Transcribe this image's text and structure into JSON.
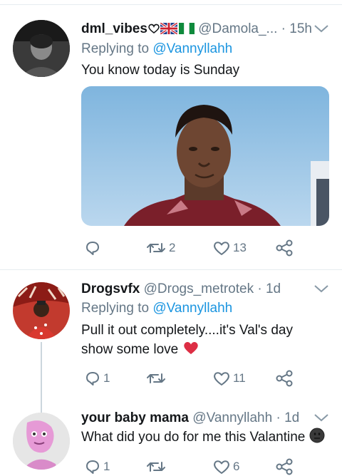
{
  "tweets": [
    {
      "display_name": "dml_vibes",
      "handle": "@Damola_...",
      "time": "· 15h",
      "replying_prefix": "Replying to",
      "replying_to": "@Vannyllahh",
      "text": "You know today is Sunday",
      "flags": [
        "white-heart",
        "uk-flag",
        "nigeria-flag"
      ],
      "has_media": true,
      "counts": {
        "reply": "",
        "retweet": "2",
        "like": "13"
      }
    },
    {
      "display_name": "Drogsvfx",
      "handle": "@Drogs_metrotek",
      "time": "· 1d",
      "replying_prefix": "Replying to",
      "replying_to": "@Vannyllahh",
      "text_line1": "Pull it out completely....it's Val's day",
      "text_line2": "show some love",
      "text_emoji": "red-heart",
      "counts": {
        "reply": "1",
        "retweet": "",
        "like": "11"
      }
    },
    {
      "display_name": "your baby mama",
      "handle": "@Vannyllahh",
      "time": "· 1d",
      "text": "What did you do for me this Valantine",
      "text_emoji": "dark-face",
      "counts": {
        "reply": "1",
        "retweet": "",
        "like": "6"
      }
    }
  ],
  "colors": {
    "icon": "#657786",
    "link": "#1b95e0",
    "text": "#14171a",
    "heart": "#e0245e",
    "divider": "#e6ecf0"
  }
}
